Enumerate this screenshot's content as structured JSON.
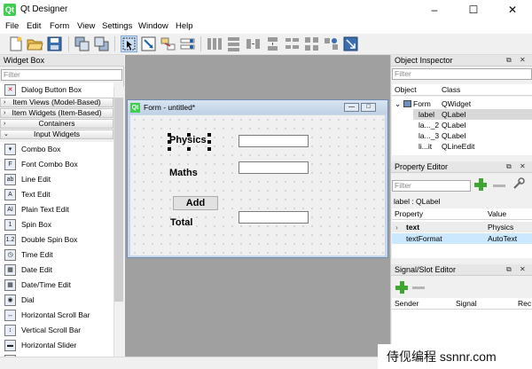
{
  "window": {
    "title": "Qt Designer",
    "app_icon": "Qt",
    "minimize": "–",
    "maximize": "☐",
    "close": "✕"
  },
  "menubar": [
    "File",
    "Edit",
    "Form",
    "View",
    "Settings",
    "Window",
    "Help"
  ],
  "widget_box": {
    "title": "Widget Box",
    "filter_placeholder": "Filter",
    "items_top": [
      {
        "label": "Dialog Button Box",
        "icon": "dialog-button-box-icon",
        "glyph": "✕"
      }
    ],
    "categories": [
      "Item Views (Model-Based)",
      "Item Widgets (Item-Based)",
      "Containers",
      "Input Widgets"
    ],
    "input_widgets": [
      {
        "label": "Combo Box",
        "icon": "combo-box-icon",
        "glyph": "▾"
      },
      {
        "label": "Font Combo Box",
        "icon": "font-combo-box-icon",
        "glyph": "F"
      },
      {
        "label": "Line Edit",
        "icon": "line-edit-icon",
        "glyph": "ab"
      },
      {
        "label": "Text Edit",
        "icon": "text-edit-icon",
        "glyph": "A"
      },
      {
        "label": "Plain Text Edit",
        "icon": "plain-text-edit-icon",
        "glyph": "AI"
      },
      {
        "label": "Spin Box",
        "icon": "spin-box-icon",
        "glyph": "1"
      },
      {
        "label": "Double Spin Box",
        "icon": "double-spin-box-icon",
        "glyph": "1.2"
      },
      {
        "label": "Time Edit",
        "icon": "time-edit-icon",
        "glyph": "◷"
      },
      {
        "label": "Date Edit",
        "icon": "date-edit-icon",
        "glyph": "▦"
      },
      {
        "label": "Date/Time Edit",
        "icon": "date-time-edit-icon",
        "glyph": "▦"
      },
      {
        "label": "Dial",
        "icon": "dial-icon",
        "glyph": "◉"
      },
      {
        "label": "Horizontal Scroll Bar",
        "icon": "horizontal-scroll-bar-icon",
        "glyph": "↔"
      },
      {
        "label": "Vertical Scroll Bar",
        "icon": "vertical-scroll-bar-icon",
        "glyph": "↕"
      },
      {
        "label": "Horizontal Slider",
        "icon": "horizontal-slider-icon",
        "glyph": "▬"
      },
      {
        "label": "Vertical Slider",
        "icon": "vertical-slider-icon",
        "glyph": "▮"
      }
    ]
  },
  "form": {
    "title": "Form - untitled*",
    "icon": "Qt",
    "labels": {
      "physics": "Physics",
      "maths": "Maths",
      "total": "Total"
    },
    "add_button": "Add"
  },
  "object_inspector": {
    "title": "Object Inspector",
    "filter_placeholder": "Filter",
    "columns": [
      "Object",
      "Class"
    ],
    "rows": [
      {
        "object": "Form",
        "class": "QWidget",
        "expander": "⌄",
        "icon": "form-icon"
      },
      {
        "object": "label",
        "class": "QLabel",
        "selected": true
      },
      {
        "object": "la..._2",
        "class": "QLabel"
      },
      {
        "object": "la..._3",
        "class": "QLabel"
      },
      {
        "object": "li...it",
        "class": "QLineEdit"
      }
    ]
  },
  "property_editor": {
    "title": "Property Editor",
    "filter_placeholder": "Filter",
    "context": "label : QLabel",
    "columns": [
      "Property",
      "Value"
    ],
    "rows": [
      {
        "property": "text",
        "value": "Physics",
        "expander": "›"
      },
      {
        "property": "textFormat",
        "value": "AutoText"
      }
    ]
  },
  "signal_slot_editor": {
    "title": "Signal/Slot Editor",
    "columns": [
      "Sender",
      "Signal",
      "Rec"
    ]
  },
  "watermark": "侍伣编程 ssnnr.com",
  "colors": {
    "qt_green": "#41cd52",
    "selection": "#cce8ff",
    "mdi_bg": "#a0a0a0",
    "plus_green": "#3fa635"
  }
}
